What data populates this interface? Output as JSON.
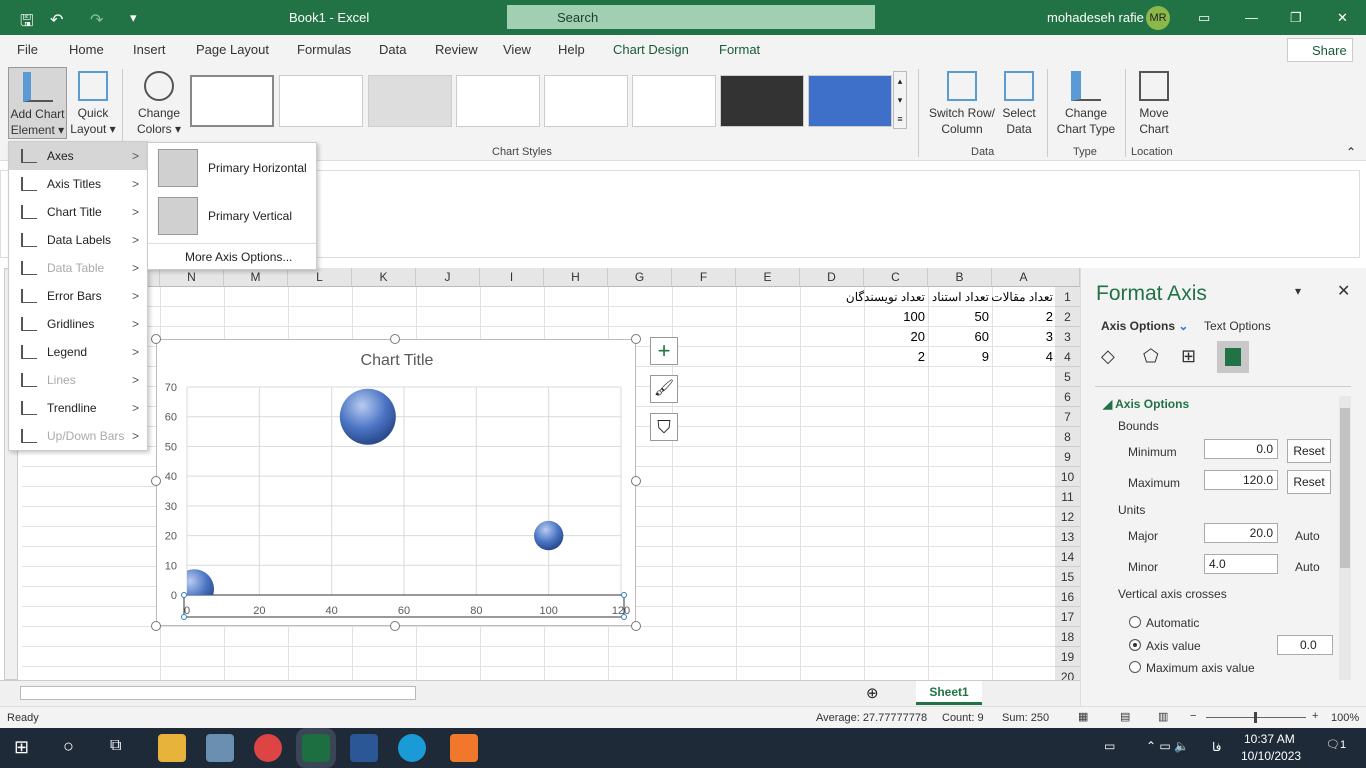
{
  "window": {
    "title": "Book1  -  Excel",
    "search": "Search",
    "user": "mohadeseh rafie",
    "initials": "MR"
  },
  "menu_tabs": [
    "File",
    "Home",
    "Insert",
    "Page Layout",
    "Formulas",
    "Data",
    "Review",
    "View",
    "Help",
    "Chart Design",
    "Format"
  ],
  "active_tab": "Chart Design",
  "share": "Share",
  "ribbon": {
    "add_chart_element": "Add Chart Element",
    "quick_layout": "Quick Layout",
    "change_colors": "Change Colors",
    "chart_styles_label": "Chart Styles",
    "switch": "Switch Row/ Column",
    "select_data": "Select Data",
    "data_label": "Data",
    "change_type": "Change Chart Type",
    "type_label": "Type",
    "move_chart": "Move Chart",
    "location_label": "Location"
  },
  "dropdown": {
    "items": [
      {
        "label": "Axes",
        "enabled": true
      },
      {
        "label": "Axis Titles",
        "enabled": true
      },
      {
        "label": "Chart Title",
        "enabled": true
      },
      {
        "label": "Data Labels",
        "enabled": true
      },
      {
        "label": "Data Table",
        "enabled": false
      },
      {
        "label": "Error Bars",
        "enabled": true
      },
      {
        "label": "Gridlines",
        "enabled": true
      },
      {
        "label": "Legend",
        "enabled": true
      },
      {
        "label": "Lines",
        "enabled": false
      },
      {
        "label": "Trendline",
        "enabled": true
      },
      {
        "label": "Up/Down Bars",
        "enabled": false
      }
    ]
  },
  "submenu": {
    "primary_horizontal": "Primary Horizontal",
    "primary_vertical": "Primary Vertical",
    "more": "More Axis Options..."
  },
  "sheet": {
    "columns": [
      "A",
      "B",
      "C",
      "D",
      "E",
      "F",
      "G",
      "H",
      "I",
      "J",
      "K",
      "L",
      "M",
      "N"
    ],
    "rows": [
      "1",
      "2",
      "3",
      "4",
      "5",
      "6",
      "7",
      "8",
      "9",
      "10",
      "11",
      "12",
      "13",
      "14",
      "15",
      "16",
      "17",
      "18",
      "19",
      "20"
    ],
    "cells": {
      "A1": "تعداد مقالات",
      "B1": "تعداد استناد",
      "C1": "تعداد نویسندگان",
      "A2": "2",
      "B2": "50",
      "C2": "100",
      "A3": "3",
      "B3": "60",
      "C3": "20",
      "A4": "4",
      "B4": "9",
      "C4": "2"
    },
    "tab": "Sheet1"
  },
  "chart_data": {
    "type": "bubble",
    "title": "Chart Title",
    "points": [
      {
        "x": 2,
        "y": 2,
        "size": 2
      },
      {
        "x": 50,
        "y": 60,
        "size": 4
      },
      {
        "x": 100,
        "y": 20,
        "size": 1.1
      }
    ],
    "xlim": [
      0,
      120
    ],
    "ylim": [
      0,
      70
    ],
    "xticks": [
      "0",
      "20",
      "40",
      "60",
      "80",
      "100",
      "120"
    ],
    "yticks": [
      "0",
      "10",
      "20",
      "30",
      "40",
      "50",
      "60",
      "70"
    ],
    "grid": true,
    "bubble_color": "#4a74c4"
  },
  "format_axis": {
    "title": "Format Axis",
    "tab_axis": "Axis Options",
    "tab_text": "Text Options",
    "section": "Axis Options",
    "bounds": "Bounds",
    "minimum_label": "Minimum",
    "minimum": "0.0",
    "maximum_label": "Maximum",
    "maximum": "120.0",
    "reset": "Reset",
    "units": "Units",
    "major_label": "Major",
    "major": "20.0",
    "minor_label": "Minor",
    "minor": "4.0",
    "auto": "Auto",
    "crosses": "Vertical axis crosses",
    "automatic": "Automatic",
    "axis_value": "Axis value",
    "axis_value_input": "0.0",
    "max_axis": "Maximum axis value"
  },
  "status": {
    "ready": "Ready",
    "average": "Average: 27.77777778",
    "count": "Count: 9",
    "sum": "Sum: 250",
    "zoom": "100%"
  },
  "taskbar": {
    "time": "10:37 AM",
    "date": "10/10/2023",
    "lang": "فا",
    "notifications": "1"
  }
}
